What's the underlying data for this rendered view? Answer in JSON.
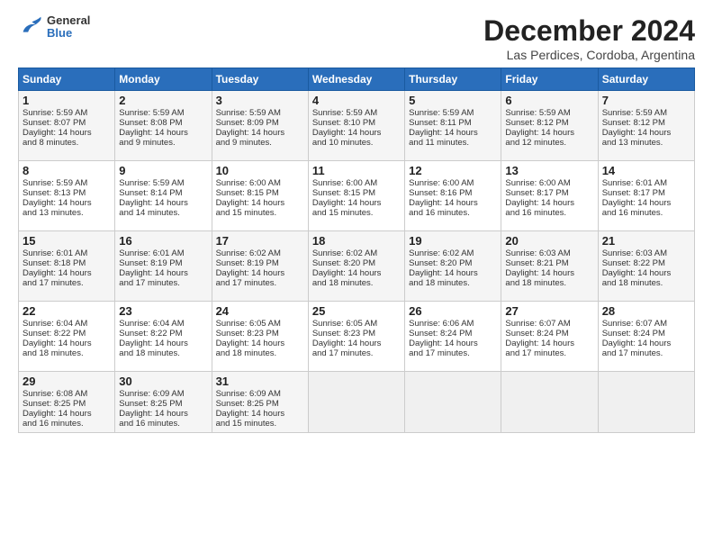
{
  "header": {
    "logo_general": "General",
    "logo_blue": "Blue",
    "month_title": "December 2024",
    "location": "Las Perdices, Cordoba, Argentina"
  },
  "days_of_week": [
    "Sunday",
    "Monday",
    "Tuesday",
    "Wednesday",
    "Thursday",
    "Friday",
    "Saturday"
  ],
  "weeks": [
    [
      {
        "day": "1",
        "sunrise": "5:59 AM",
        "sunset": "8:07 PM",
        "daylight": "14 hours and 8 minutes."
      },
      {
        "day": "2",
        "sunrise": "5:59 AM",
        "sunset": "8:08 PM",
        "daylight": "14 hours and 9 minutes."
      },
      {
        "day": "3",
        "sunrise": "5:59 AM",
        "sunset": "8:09 PM",
        "daylight": "14 hours and 9 minutes."
      },
      {
        "day": "4",
        "sunrise": "5:59 AM",
        "sunset": "8:10 PM",
        "daylight": "14 hours and 10 minutes."
      },
      {
        "day": "5",
        "sunrise": "5:59 AM",
        "sunset": "8:11 PM",
        "daylight": "14 hours and 11 minutes."
      },
      {
        "day": "6",
        "sunrise": "5:59 AM",
        "sunset": "8:12 PM",
        "daylight": "14 hours and 12 minutes."
      },
      {
        "day": "7",
        "sunrise": "5:59 AM",
        "sunset": "8:12 PM",
        "daylight": "14 hours and 13 minutes."
      }
    ],
    [
      {
        "day": "8",
        "sunrise": "5:59 AM",
        "sunset": "8:13 PM",
        "daylight": "14 hours and 13 minutes."
      },
      {
        "day": "9",
        "sunrise": "5:59 AM",
        "sunset": "8:14 PM",
        "daylight": "14 hours and 14 minutes."
      },
      {
        "day": "10",
        "sunrise": "6:00 AM",
        "sunset": "8:15 PM",
        "daylight": "14 hours and 15 minutes."
      },
      {
        "day": "11",
        "sunrise": "6:00 AM",
        "sunset": "8:15 PM",
        "daylight": "14 hours and 15 minutes."
      },
      {
        "day": "12",
        "sunrise": "6:00 AM",
        "sunset": "8:16 PM",
        "daylight": "14 hours and 16 minutes."
      },
      {
        "day": "13",
        "sunrise": "6:00 AM",
        "sunset": "8:17 PM",
        "daylight": "14 hours and 16 minutes."
      },
      {
        "day": "14",
        "sunrise": "6:01 AM",
        "sunset": "8:17 PM",
        "daylight": "14 hours and 16 minutes."
      }
    ],
    [
      {
        "day": "15",
        "sunrise": "6:01 AM",
        "sunset": "8:18 PM",
        "daylight": "14 hours and 17 minutes."
      },
      {
        "day": "16",
        "sunrise": "6:01 AM",
        "sunset": "8:19 PM",
        "daylight": "14 hours and 17 minutes."
      },
      {
        "day": "17",
        "sunrise": "6:02 AM",
        "sunset": "8:19 PM",
        "daylight": "14 hours and 17 minutes."
      },
      {
        "day": "18",
        "sunrise": "6:02 AM",
        "sunset": "8:20 PM",
        "daylight": "14 hours and 18 minutes."
      },
      {
        "day": "19",
        "sunrise": "6:02 AM",
        "sunset": "8:20 PM",
        "daylight": "14 hours and 18 minutes."
      },
      {
        "day": "20",
        "sunrise": "6:03 AM",
        "sunset": "8:21 PM",
        "daylight": "14 hours and 18 minutes."
      },
      {
        "day": "21",
        "sunrise": "6:03 AM",
        "sunset": "8:22 PM",
        "daylight": "14 hours and 18 minutes."
      }
    ],
    [
      {
        "day": "22",
        "sunrise": "6:04 AM",
        "sunset": "8:22 PM",
        "daylight": "14 hours and 18 minutes."
      },
      {
        "day": "23",
        "sunrise": "6:04 AM",
        "sunset": "8:22 PM",
        "daylight": "14 hours and 18 minutes."
      },
      {
        "day": "24",
        "sunrise": "6:05 AM",
        "sunset": "8:23 PM",
        "daylight": "14 hours and 18 minutes."
      },
      {
        "day": "25",
        "sunrise": "6:05 AM",
        "sunset": "8:23 PM",
        "daylight": "14 hours and 17 minutes."
      },
      {
        "day": "26",
        "sunrise": "6:06 AM",
        "sunset": "8:24 PM",
        "daylight": "14 hours and 17 minutes."
      },
      {
        "day": "27",
        "sunrise": "6:07 AM",
        "sunset": "8:24 PM",
        "daylight": "14 hours and 17 minutes."
      },
      {
        "day": "28",
        "sunrise": "6:07 AM",
        "sunset": "8:24 PM",
        "daylight": "14 hours and 17 minutes."
      }
    ],
    [
      {
        "day": "29",
        "sunrise": "6:08 AM",
        "sunset": "8:25 PM",
        "daylight": "14 hours and 16 minutes."
      },
      {
        "day": "30",
        "sunrise": "6:09 AM",
        "sunset": "8:25 PM",
        "daylight": "14 hours and 16 minutes."
      },
      {
        "day": "31",
        "sunrise": "6:09 AM",
        "sunset": "8:25 PM",
        "daylight": "14 hours and 15 minutes."
      },
      null,
      null,
      null,
      null
    ]
  ]
}
